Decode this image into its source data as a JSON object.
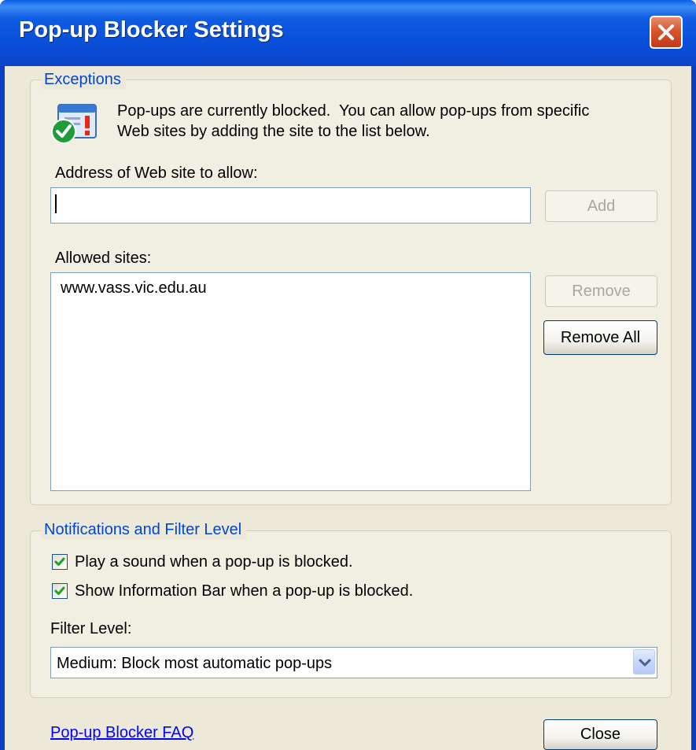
{
  "window": {
    "title": "Pop-up Blocker Settings"
  },
  "exceptions": {
    "legend": "Exceptions",
    "intro_line1": "Pop-ups are currently blocked.  You can allow pop-ups from specific",
    "intro_line2": "Web sites by adding the site to the list below.",
    "address_label": "Address of Web site to allow:",
    "address_value": "",
    "add_button": "Add",
    "allowed_label": "Allowed sites:",
    "allowed_sites": [
      "www.vass.vic.edu.au"
    ],
    "remove_button": "Remove",
    "remove_all_button": "Remove All"
  },
  "notifications": {
    "legend": "Notifications and Filter Level",
    "play_sound_label": "Play a sound when a pop-up is blocked.",
    "play_sound_checked": true,
    "show_infobar_label": "Show Information Bar when a pop-up is blocked.",
    "show_infobar_checked": true,
    "filter_level_label": "Filter Level:",
    "filter_level_value": "Medium: Block most automatic pop-ups"
  },
  "footer": {
    "faq_link": "Pop-up Blocker FAQ",
    "close_button": "Close"
  },
  "colors": {
    "title_bar": "#0a52da",
    "dialog_face": "#ece9d8",
    "group_legend": "#0046d5",
    "link": "#0000ff",
    "close_button": "#d9542c",
    "check_mark": "#21a121"
  }
}
